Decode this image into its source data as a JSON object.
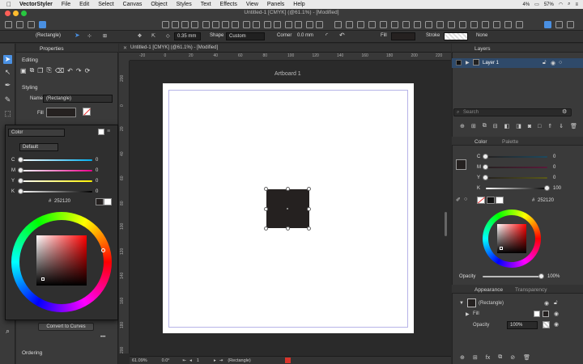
{
  "menubar": {
    "app": "VectorStyler",
    "items": [
      "File",
      "Edit",
      "Select",
      "Canvas",
      "Object",
      "Styles",
      "Text",
      "Effects",
      "View",
      "Panels",
      "Help"
    ],
    "battery": "57%",
    "cpu": "4%"
  },
  "window": {
    "title": "Untitled-1 [CMYK] (@61.1%) - [Modified]"
  },
  "context_bar": {
    "object_type": "(Rectangle)",
    "stroke_width": "0.35 mm",
    "shape_label": "Shape",
    "shape_value": "Custom",
    "corner_label": "Corner",
    "corner_value": "0.0 mm",
    "fill_label": "Fill",
    "stroke_label": "Stroke",
    "stroke_value": "None"
  },
  "properties": {
    "tab_title": "Properties",
    "editing_label": "Editing",
    "styling_label": "Styling",
    "name_label": "Name",
    "name_value": "(Rectangle)",
    "fill_label": "Fill",
    "convert_button": "Convert to Curves",
    "ordering_label": "Ordering",
    "more": "•••"
  },
  "color_popover": {
    "mode": "Color",
    "preset": "Default",
    "channels": [
      {
        "label": "C",
        "value": "0"
      },
      {
        "label": "M",
        "value": "0"
      },
      {
        "label": "Y",
        "value": "0"
      },
      {
        "label": "K",
        "value": "0"
      }
    ],
    "hex_label": "#",
    "hex_value": "252120"
  },
  "canvas": {
    "tab": "Untitled-1 [CMYK] (@61.1%) - [Modified]",
    "artboard_label": "Artboard 1",
    "ruler_h": [
      "-20",
      "0",
      "20",
      "40",
      "60",
      "80",
      "100",
      "120",
      "140",
      "160",
      "180",
      "200",
      "220"
    ],
    "ruler_v": [
      "200",
      "0",
      "20",
      "40",
      "60",
      "80",
      "100",
      "120",
      "140",
      "160",
      "180",
      "200"
    ],
    "status": {
      "zoom": "61.09%",
      "angle": "0.0°",
      "page": "1",
      "selection": "(Rectangle)"
    }
  },
  "layers": {
    "title": "Layers",
    "layer_name": "Layer 1",
    "search_placeholder": "Search"
  },
  "color_panel": {
    "tab_color": "Color",
    "tab_palette": "Palette",
    "channels": [
      {
        "label": "C",
        "value": "0"
      },
      {
        "label": "M",
        "value": "0"
      },
      {
        "label": "Y",
        "value": "0"
      },
      {
        "label": "K",
        "value": "100"
      }
    ],
    "hex_label": "#",
    "hex_value": "252120",
    "opacity_label": "Opacity",
    "opacity_value": "100%"
  },
  "appearance": {
    "tab_appearance": "Appearance",
    "tab_transparency": "Transparency",
    "object": "(Rectangle)",
    "fill_label": "Fill",
    "opacity_label": "Opacity",
    "opacity_value": "100%"
  },
  "colors": {
    "accent": "#4a90e2",
    "fill_color": "#252120",
    "panel_bg": "#3a3a3a",
    "canvas_bg": "#2a2a2a",
    "margin_guide": "#b7b4e8"
  }
}
